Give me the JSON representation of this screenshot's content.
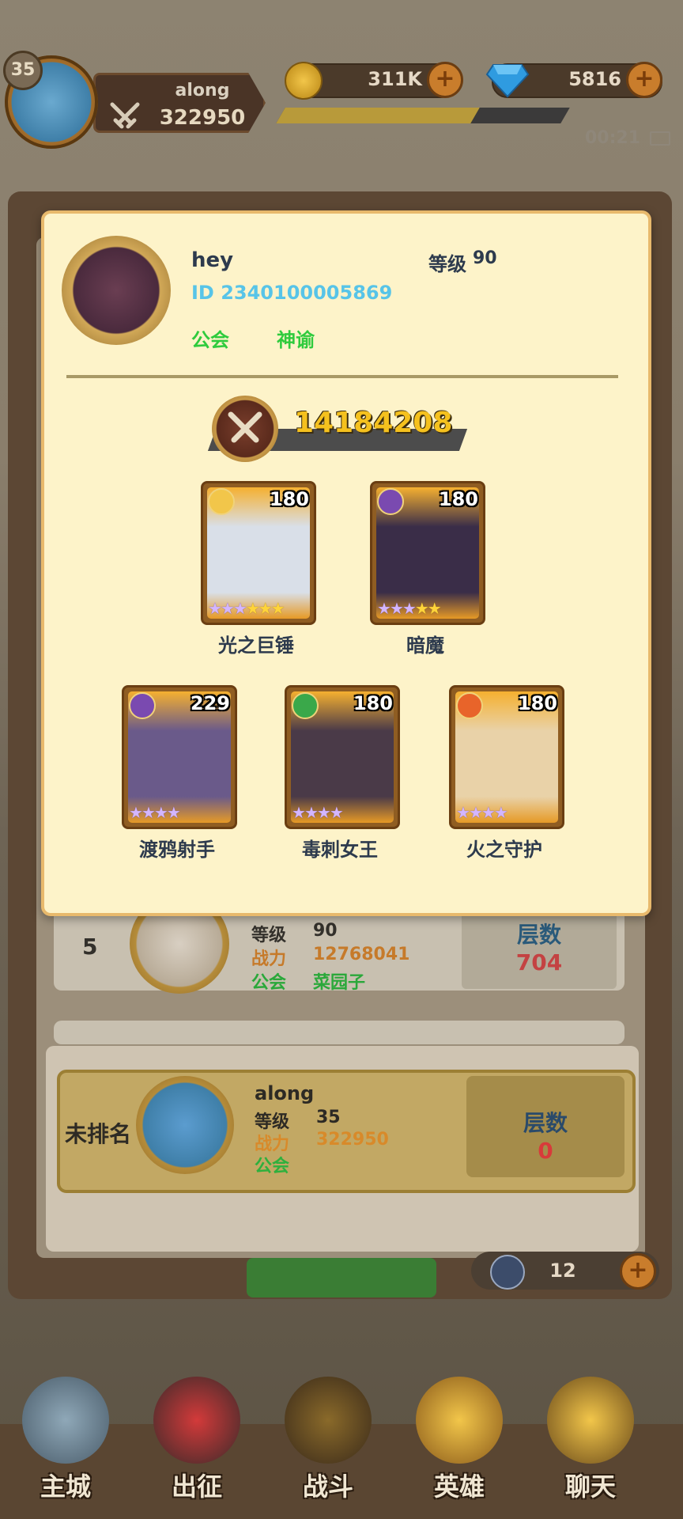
{
  "top_bar": {
    "player_level": "35",
    "player_name": "along",
    "player_power": "322950",
    "gold": "311K",
    "gems": "5816",
    "time": "00:21"
  },
  "popup": {
    "name": "hey",
    "id_text": "ID 2340100005869",
    "guild_label": "公会",
    "guild_name": "神谕",
    "level_label": "等级",
    "level_value": "90",
    "power": "14184208",
    "heroes": [
      {
        "name": "光之巨锤",
        "level": "180",
        "element": "light",
        "purple_stars": 3,
        "gold_stars": 3,
        "color": "#d9dfe8"
      },
      {
        "name": "暗魔",
        "level": "180",
        "element": "dark",
        "purple_stars": 3,
        "gold_stars": 2,
        "color": "#3a2d48"
      },
      {
        "name": "渡鸦射手",
        "level": "229",
        "element": "dark",
        "purple_stars": 4,
        "gold_stars": 0,
        "color": "#6a5a8a"
      },
      {
        "name": "毒刺女王",
        "level": "180",
        "element": "nature",
        "purple_stars": 4,
        "gold_stars": 0,
        "color": "#4a3a48"
      },
      {
        "name": "火之守护",
        "level": "180",
        "element": "fire",
        "purple_stars": 4,
        "gold_stars": 0,
        "color": "#e9d2a8"
      }
    ]
  },
  "ranking": {
    "row5": {
      "rank": "5",
      "level_label": "等级",
      "level": "90",
      "power_label": "战力",
      "power": "12768041",
      "guild_label": "公会",
      "guild": "菜园子",
      "floors_label": "层数",
      "floors": "704"
    },
    "me": {
      "rank_text": "未排名",
      "name": "along",
      "level_label": "等级",
      "level": "35",
      "power_label": "战力",
      "power": "322950",
      "guild_label": "公会",
      "floors_label": "层数",
      "floors": "0"
    },
    "skip_count": "12"
  },
  "nav": {
    "items": [
      "主城",
      "出征",
      "战斗",
      "英雄",
      "聊天"
    ]
  },
  "colors": {
    "popup_bg": "#fdf3c9",
    "id_blue": "#57c4e8",
    "guild_green": "#2fcb3d",
    "power_gold": "#f5c11e",
    "power_orange": "#e08a2a",
    "floor_red": "#d83a3a"
  }
}
